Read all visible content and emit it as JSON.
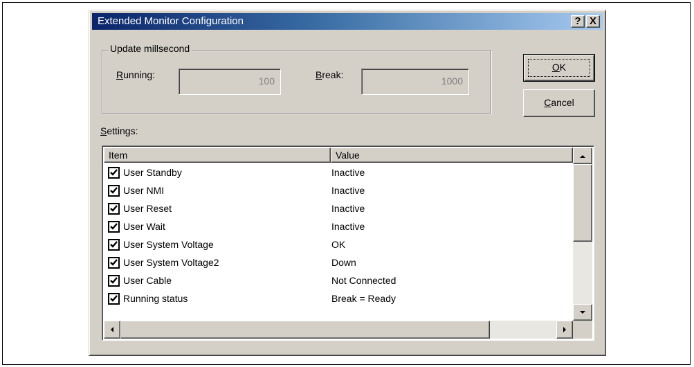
{
  "dialog": {
    "title": "Extended Monitor Configuration",
    "help_label": "?",
    "close_label": "X"
  },
  "update": {
    "group_label": "Update millsecond",
    "running_label_first": "R",
    "running_label_rest": "unning:",
    "running_value": "100",
    "break_label_first": "B",
    "break_label_rest": "reak:",
    "break_value": "1000"
  },
  "buttons": {
    "ok_first": "O",
    "ok_rest": "K",
    "cancel_first": "C",
    "cancel_rest": "ancel"
  },
  "settings": {
    "label_first": "S",
    "label_rest": "ettings:",
    "columns": [
      "Item",
      "Value"
    ],
    "rows": [
      {
        "item": "User Standby",
        "value": "Inactive",
        "checked": true
      },
      {
        "item": "User NMI",
        "value": "Inactive",
        "checked": true
      },
      {
        "item": "User Reset",
        "value": "Inactive",
        "checked": true
      },
      {
        "item": "User Wait",
        "value": "Inactive",
        "checked": true
      },
      {
        "item": "User System Voltage",
        "value": "OK",
        "checked": true
      },
      {
        "item": "User System Voltage2",
        "value": "Down",
        "checked": true
      },
      {
        "item": "User Cable",
        "value": "Not Connected",
        "checked": true
      },
      {
        "item": "Running status",
        "value": "Break = Ready",
        "checked": true
      }
    ]
  },
  "colors": {
    "title_start": "#0a246a",
    "title_end": "#a6caf0",
    "face": "#d4d0c8"
  }
}
